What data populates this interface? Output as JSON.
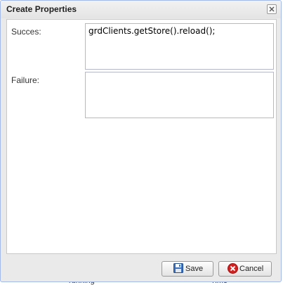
{
  "window": {
    "title": "Create Properties"
  },
  "form": {
    "success_label": "Succes:",
    "success_value": "grdClients.getStore().reload();",
    "failure_label": "Failure:",
    "failure_value": ""
  },
  "footer": {
    "save_label": "Save",
    "cancel_label": "Cancel"
  },
  "background": {
    "left_text": "running",
    "right_text": "Time"
  },
  "icons": {
    "close": "close-icon",
    "save": "floppy-disk-icon",
    "cancel": "cancel-circle-icon"
  },
  "colors": {
    "window_bg": "#eaeaea",
    "panel_bg": "#ffffff",
    "cancel_red": "#d42020",
    "save_blue": "#3a6fbf"
  }
}
